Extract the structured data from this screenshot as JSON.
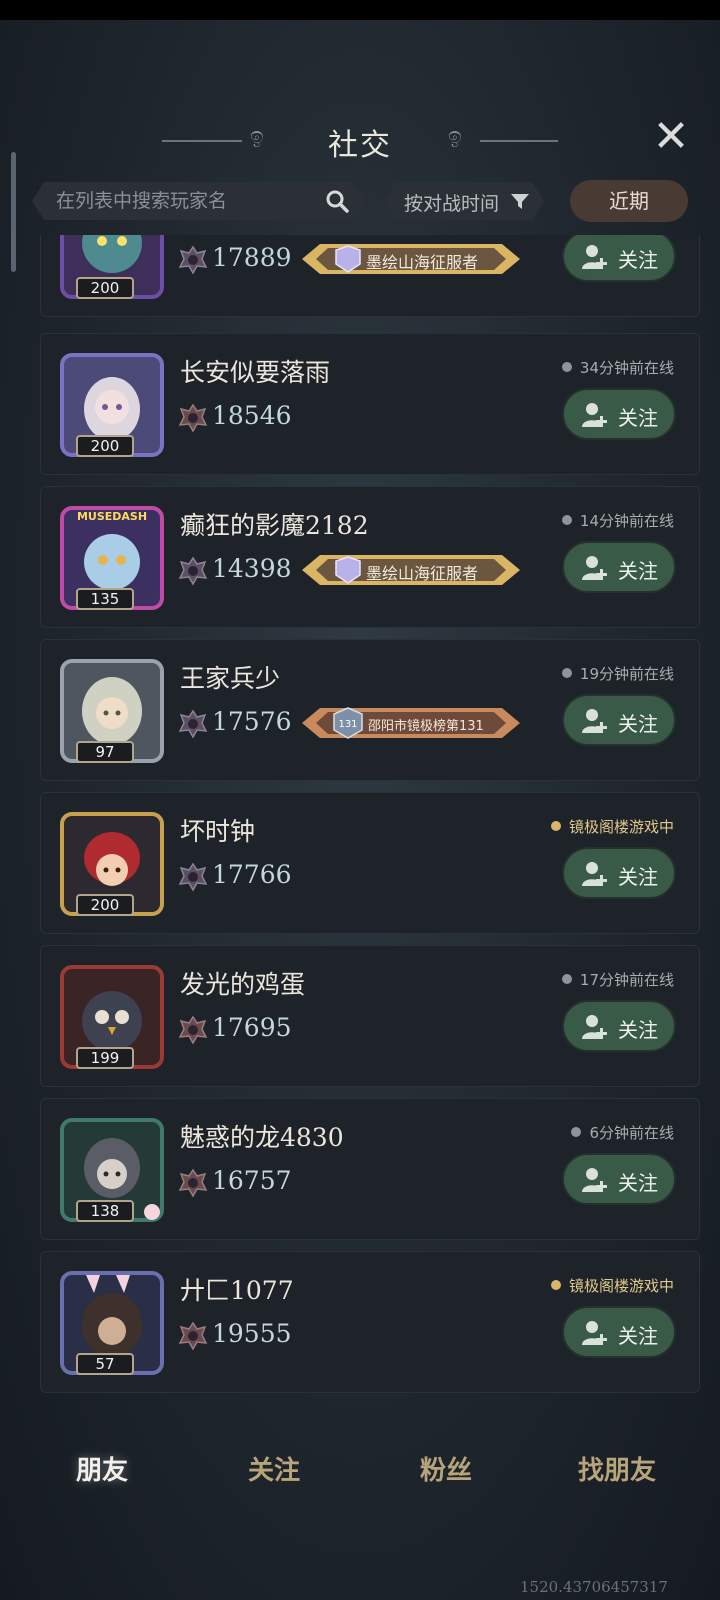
{
  "header": {
    "title": "社交"
  },
  "search": {
    "placeholder": "在列表中搜索玩家名"
  },
  "sort": {
    "label": "按对战时间"
  },
  "filter": {
    "recent_label": "近期"
  },
  "players": [
    {
      "name": "",
      "level": "200",
      "score": "17889",
      "status": "",
      "badge": "墨绘山海征服者",
      "follow_label": "关注"
    },
    {
      "name": "长安似要落雨",
      "level": "200",
      "score": "18546",
      "status": "34分钟前在线",
      "badge": "",
      "follow_label": "关注"
    },
    {
      "name": "癫狂的影魔2182",
      "level": "135",
      "score": "14398",
      "status": "14分钟前在线",
      "badge": "墨绘山海征服者",
      "follow_label": "关注",
      "frame_label": "MUSEDASH"
    },
    {
      "name": "王家兵少",
      "level": "97",
      "score": "17576",
      "status": "19分钟前在线",
      "badge": "邵阳市镜极榜第131",
      "badge_rank": "131",
      "follow_label": "关注"
    },
    {
      "name": "坏时钟",
      "level": "200",
      "score": "17766",
      "status": "镜极阁楼游戏中",
      "badge": "",
      "follow_label": "关注"
    },
    {
      "name": "发光的鸡蛋",
      "level": "199",
      "score": "17695",
      "status": "17分钟前在线",
      "badge": "",
      "follow_label": "关注"
    },
    {
      "name": "魅惑的龙4830",
      "level": "138",
      "score": "16757",
      "status": "6分钟前在线",
      "badge": "",
      "follow_label": "关注"
    },
    {
      "name": "廾匚1077",
      "level": "57",
      "score": "19555",
      "status": "镜极阁楼游戏中",
      "badge": "",
      "follow_label": "关注"
    }
  ],
  "tabs": [
    {
      "label": "朋友"
    },
    {
      "label": "关注"
    },
    {
      "label": "粉丝"
    },
    {
      "label": "找朋友"
    }
  ],
  "debug_readout": "1520.43706457317",
  "colors": {
    "accent_green": "#3a5a48",
    "gold": "#d8b76a",
    "card_bg": "#1d2329"
  }
}
